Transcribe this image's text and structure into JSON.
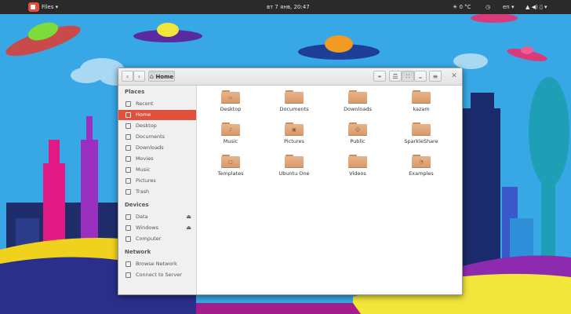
{
  "topbar": {
    "activities": "Files ▾",
    "clock": "вт 7 янв, 20:47",
    "weather": "☀ 0 °C",
    "keyboard": "en ▾",
    "status": "▲ ◀) ▯ ▾"
  },
  "header": {
    "back": "‹",
    "forward": "›",
    "path": "Home",
    "locate": "⌖",
    "list_view": "☰",
    "grid_view": "∷",
    "sort": "⌄",
    "menu": "≡",
    "close": "✕"
  },
  "sidebar": {
    "places_title": "Places",
    "places": [
      {
        "label": "Recent",
        "icon": "clock-icon"
      },
      {
        "label": "Home",
        "icon": "home-icon",
        "active": true
      },
      {
        "label": "Desktop",
        "icon": "desktop-icon"
      },
      {
        "label": "Documents",
        "icon": "documents-icon"
      },
      {
        "label": "Downloads",
        "icon": "downloads-icon"
      },
      {
        "label": "Movies",
        "icon": "movies-icon"
      },
      {
        "label": "Music",
        "icon": "music-icon"
      },
      {
        "label": "Pictures",
        "icon": "pictures-icon"
      },
      {
        "label": "Trash",
        "icon": "trash-icon"
      }
    ],
    "devices_title": "Devices",
    "devices": [
      {
        "label": "Data",
        "icon": "drive-icon",
        "eject": "⏏"
      },
      {
        "label": "Windows",
        "icon": "drive-icon",
        "eject": "⏏"
      },
      {
        "label": "Computer",
        "icon": "computer-icon"
      }
    ],
    "network_title": "Network",
    "network": [
      {
        "label": "Browse Network",
        "icon": "network-icon"
      },
      {
        "label": "Connect to Server",
        "icon": "server-icon"
      }
    ]
  },
  "files": [
    {
      "label": "Desktop",
      "emblem": "▭"
    },
    {
      "label": "Documents",
      "emblem": ""
    },
    {
      "label": "Downloads",
      "emblem": ""
    },
    {
      "label": "kazam",
      "emblem": ""
    },
    {
      "label": "Music",
      "emblem": "♪"
    },
    {
      "label": "Pictures",
      "emblem": "▣"
    },
    {
      "label": "Public",
      "emblem": "☺"
    },
    {
      "label": "SparkleShare",
      "emblem": ""
    },
    {
      "label": "Templates",
      "emblem": "□"
    },
    {
      "label": "Ubuntu One",
      "emblem": ""
    },
    {
      "label": "Videos",
      "emblem": ""
    },
    {
      "label": "Examples",
      "emblem": "◔"
    }
  ],
  "colors": {
    "accent": "#e2503c",
    "folder": "#e3a97c",
    "topbar": "#2a2a2a",
    "sky": "#37a7e6"
  }
}
